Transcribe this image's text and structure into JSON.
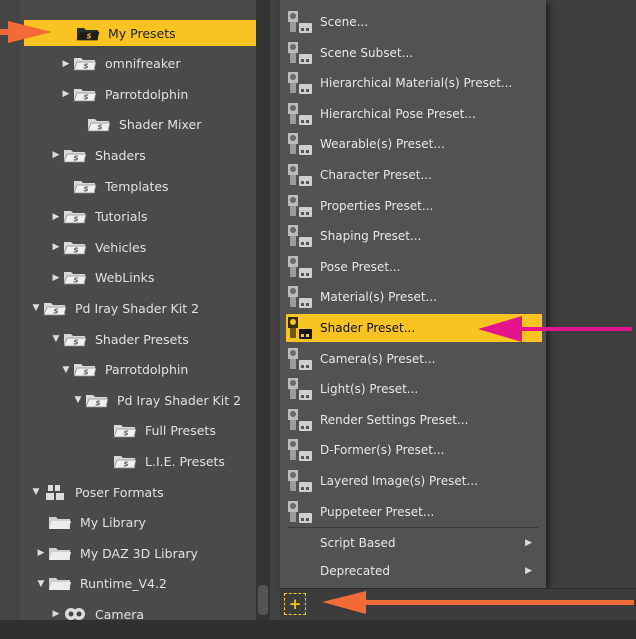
{
  "tree": {
    "items": [
      {
        "label": "My Presets",
        "arrow": "",
        "selected": true
      },
      {
        "label": "omnifreaker",
        "arrow": "▶"
      },
      {
        "label": "Parrotdolphin",
        "arrow": "▶"
      },
      {
        "label": "Shader Mixer",
        "arrow": ""
      },
      {
        "label": "Shaders",
        "arrow": "▶"
      },
      {
        "label": "Templates",
        "arrow": ""
      },
      {
        "label": "Tutorials",
        "arrow": "▶"
      },
      {
        "label": "Vehicles",
        "arrow": "▶"
      },
      {
        "label": "WebLinks",
        "arrow": "▶"
      },
      {
        "label": "Pd Iray Shader Kit 2",
        "arrow": "▼"
      },
      {
        "label": "Shader Presets",
        "arrow": "▼"
      },
      {
        "label": "Parrotdolphin",
        "arrow": "▼"
      },
      {
        "label": "Pd Iray Shader Kit 2",
        "arrow": "▼"
      },
      {
        "label": "Full Presets",
        "arrow": ""
      },
      {
        "label": "L.I.E. Presets",
        "arrow": ""
      },
      {
        "label": "Poser Formats",
        "arrow": "▼"
      },
      {
        "label": "My Library",
        "arrow": ""
      },
      {
        "label": "My DAZ 3D Library",
        "arrow": "▶"
      },
      {
        "label": "Runtime_V4.2",
        "arrow": "▼"
      },
      {
        "label": "Camera",
        "arrow": "▶"
      }
    ]
  },
  "menu": {
    "items": [
      {
        "label": "Scene...",
        "icon": "scene-preset-icon"
      },
      {
        "label": "Scene Subset...",
        "icon": "scene-subset-icon"
      },
      {
        "label": "Hierarchical Material(s) Preset...",
        "icon": "hierarchical-material-icon"
      },
      {
        "label": "Hierarchical Pose Preset...",
        "icon": "hierarchical-pose-icon"
      },
      {
        "label": "Wearable(s) Preset...",
        "icon": "wearable-icon"
      },
      {
        "label": "Character Preset...",
        "icon": "character-icon"
      },
      {
        "label": "Properties Preset...",
        "icon": "properties-icon"
      },
      {
        "label": "Shaping Preset...",
        "icon": "shaping-icon"
      },
      {
        "label": "Pose Preset...",
        "icon": "pose-icon"
      },
      {
        "label": "Material(s) Preset...",
        "icon": "material-icon"
      },
      {
        "label": "Shader Preset...",
        "icon": "shader-preset-icon",
        "highlighted": true
      },
      {
        "label": "Camera(s) Preset...",
        "icon": "camera-preset-icon"
      },
      {
        "label": "Light(s) Preset...",
        "icon": "light-preset-icon"
      },
      {
        "label": "Render Settings Preset...",
        "icon": "render-settings-icon"
      },
      {
        "label": "D-Former(s) Preset...",
        "icon": "dformer-icon"
      },
      {
        "label": "Layered Image(s) Preset...",
        "icon": "layered-image-icon"
      },
      {
        "label": "Puppeteer Preset...",
        "icon": "puppeteer-icon"
      }
    ],
    "submenus": [
      {
        "label": "Script Based",
        "arrow": "▶"
      },
      {
        "label": "Deprecated",
        "arrow": "▶"
      }
    ]
  },
  "toolbar": {
    "add_label": "+"
  },
  "colors": {
    "accent": "#f9c321",
    "arrow_orange": "#f26a35",
    "arrow_magenta": "#e5148c"
  }
}
